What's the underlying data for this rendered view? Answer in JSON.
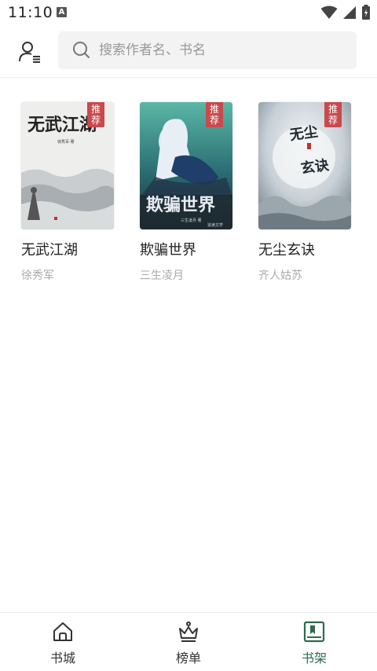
{
  "status_bar": {
    "time": "11:10",
    "notification_letter": "A"
  },
  "header": {
    "search_placeholder": "搜索作者名、书名"
  },
  "books": [
    {
      "title": "无武江湖",
      "author": "徐秀军",
      "badge": "推荐",
      "cover_text": "无武江湖"
    },
    {
      "title": "欺骗世界",
      "author": "三生凌月",
      "badge": "推荐",
      "cover_text": "欺骗世界"
    },
    {
      "title": "无尘玄诀",
      "author": "齐人姑苏",
      "badge": "推荐",
      "cover_text": "无尘玄诀"
    }
  ],
  "bottom_nav": [
    {
      "label": "书城",
      "icon": "home-icon",
      "active": false
    },
    {
      "label": "榜单",
      "icon": "crown-icon",
      "active": false
    },
    {
      "label": "书架",
      "icon": "bookshelf-icon",
      "active": true
    }
  ],
  "colors": {
    "accent": "#2e6b4f",
    "badge": "#c9494d",
    "search_bg": "#f3f3f3"
  }
}
